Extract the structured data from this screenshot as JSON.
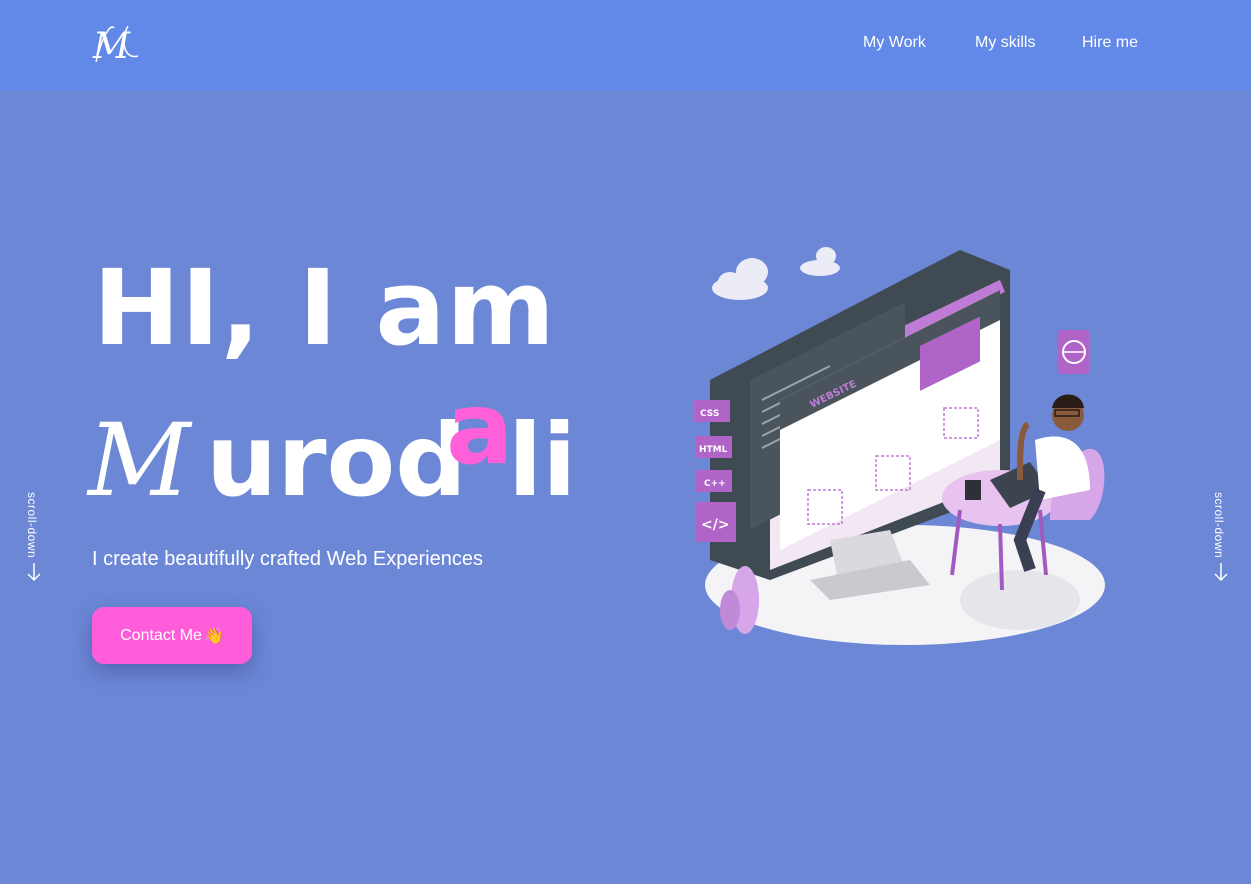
{
  "nav": {
    "logo_text": "M",
    "links": [
      "My Work",
      "My skills",
      "Hire me"
    ]
  },
  "hero": {
    "title": "HI, I am",
    "name_initial": "M",
    "name_mid": "urod",
    "name_accent": "a",
    "name_tail": "li",
    "tagline": "I create beautifully crafted Web Experiences",
    "cta_label": "Contact Me",
    "cta_emoji": "👋"
  },
  "scroll": {
    "left_label": "scroll-down",
    "right_label": "scroll-down",
    "icon": "arrow-down-icon"
  },
  "illustration": {
    "tags": [
      "CSS",
      "HTML",
      "C++",
      "</>"
    ],
    "window_title": "WEBSITE"
  },
  "colors": {
    "background": "#6b87d6",
    "navbar": "#6389e8",
    "accent": "#ff5fd8",
    "text": "#ffffff"
  }
}
